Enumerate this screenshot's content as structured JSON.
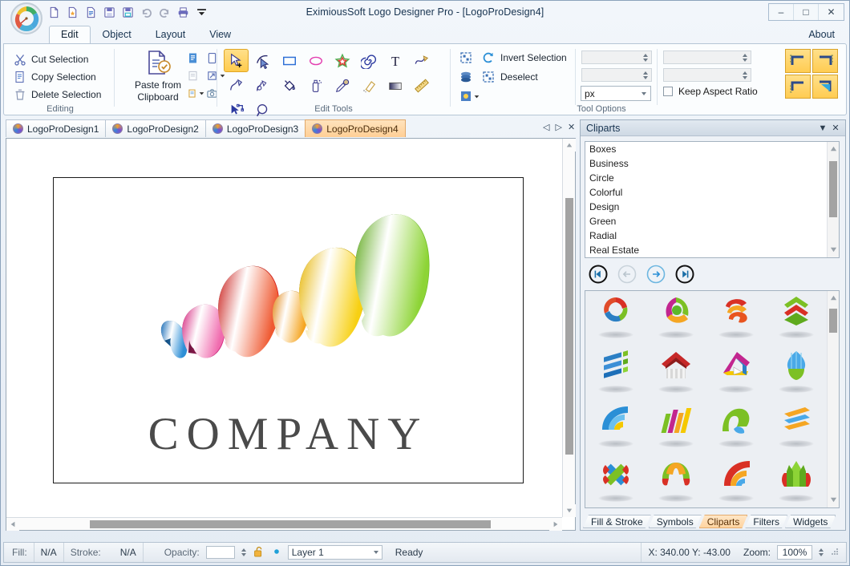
{
  "window": {
    "title": "EximiousSoft Logo Designer Pro - [LogoProDesign4]",
    "minimize": "–",
    "maximize": "□",
    "close": "✕"
  },
  "quick_access": [
    {
      "name": "new-document-icon",
      "tip": "New"
    },
    {
      "name": "new-from-template-icon",
      "tip": "New from template"
    },
    {
      "name": "open-document-icon",
      "tip": "Open"
    },
    {
      "name": "save-icon",
      "tip": "Save"
    },
    {
      "name": "save-as-icon",
      "tip": "Save As"
    },
    {
      "name": "undo-icon",
      "tip": "Undo"
    },
    {
      "name": "redo-icon",
      "tip": "Redo"
    },
    {
      "name": "print-icon",
      "tip": "Print"
    },
    {
      "name": "customize-qat-icon",
      "tip": "Customize"
    }
  ],
  "ribbon": {
    "tabs": [
      "Edit",
      "Object",
      "Layout",
      "View"
    ],
    "active_tab": "Edit",
    "about_label": "About",
    "groups": {
      "editing": {
        "label": "Editing",
        "items": [
          {
            "label": "Cut Selection",
            "icon": "scissors-icon"
          },
          {
            "label": "Copy Selection",
            "icon": "copy-icon"
          },
          {
            "label": "Delete Selection",
            "icon": "trash-icon"
          }
        ],
        "paste_label_line1": "Paste from",
        "paste_label_line2": "Clipboard"
      },
      "edit_tools": {
        "label": "Edit Tools",
        "tools": [
          {
            "name": "select-tool",
            "selected": true
          },
          {
            "name": "node-edit-tool",
            "selected": false
          },
          {
            "name": "rectangle-tool",
            "selected": false
          },
          {
            "name": "ellipse-tool",
            "selected": false
          },
          {
            "name": "star-tool",
            "selected": false
          },
          {
            "name": "spiral-tool",
            "selected": false
          },
          {
            "name": "text-tool",
            "selected": false
          },
          {
            "name": "curve-tool",
            "selected": false
          },
          {
            "name": "pen-tool",
            "selected": false
          },
          {
            "name": "calligraphy-tool",
            "selected": false
          },
          {
            "name": "paint-bucket-tool",
            "selected": false
          },
          {
            "name": "spray-tool",
            "selected": false
          },
          {
            "name": "eyedropper-tool",
            "selected": false
          },
          {
            "name": "eraser-tool",
            "selected": false
          },
          {
            "name": "gradient-tool",
            "selected": false
          },
          {
            "name": "measure-tool",
            "selected": false
          },
          {
            "name": "connector-tool",
            "selected": false
          },
          {
            "name": "zoom-tool",
            "selected": false
          }
        ]
      },
      "tool_options": {
        "label": "Tool Options",
        "select_all_icon": "select-all-icon",
        "stack_icon": "stack-icon",
        "selection_mode_icon": "selection-mode-icon",
        "invert_selection": "Invert Selection",
        "deselect": "Deselect",
        "x_value": "",
        "y_value": "",
        "w_value": "",
        "h_value": "",
        "unit_value": "px",
        "keep_aspect_ratio": "Keep Aspect Ratio",
        "keep_aspect_checked": false,
        "anchor_buttons": [
          "anchor-top-left",
          "anchor-top-right",
          "anchor-bottom-left",
          "anchor-bottom-right"
        ]
      }
    }
  },
  "document_tabs": {
    "tabs": [
      {
        "label": "LogoProDesign1",
        "active": false
      },
      {
        "label": "LogoProDesign2",
        "active": false
      },
      {
        "label": "LogoProDesign3",
        "active": false
      },
      {
        "label": "LogoProDesign4",
        "active": true
      }
    ],
    "nav_prev": "◁",
    "nav_next": "▷",
    "nav_close": "✕"
  },
  "canvas": {
    "company_text": "COMPANY",
    "artwork_name": "colorful-3d-spiral-logo",
    "spiral_colors": [
      "#2e8fd6",
      "#ec4899",
      "#e8342c",
      "#f59a1e",
      "#f5c800",
      "#7ac832"
    ]
  },
  "right_panel": {
    "title": "Cliparts",
    "collapse_icon": "▼",
    "close_icon": "✕",
    "categories": [
      "Boxes",
      "Business",
      "Circle",
      "Colorful",
      "Design",
      "Green",
      "Radial",
      "Real Estate"
    ],
    "nav_buttons": [
      {
        "name": "first-page-button",
        "glyph": "⏮",
        "enabled": true
      },
      {
        "name": "previous-page-button",
        "glyph": "←",
        "enabled": false
      },
      {
        "name": "next-page-button",
        "glyph": "→",
        "enabled": true
      },
      {
        "name": "last-page-button",
        "glyph": "⏭",
        "enabled": true
      }
    ],
    "cliparts": [
      {
        "name": "circular-arrows-clipart",
        "colors": [
          "#e03131",
          "#76bc21",
          "#2f86cf"
        ]
      },
      {
        "name": "triangle-swirl-clipart",
        "colors": [
          "#c2268f",
          "#76bc21",
          "#f5a623"
        ]
      },
      {
        "name": "layered-circle-clipart",
        "colors": [
          "#e03131",
          "#f5a623",
          "#76bc21"
        ]
      },
      {
        "name": "green-chevron-shield-clipart",
        "colors": [
          "#76bc21",
          "#e03131",
          "#2f8f1e"
        ]
      },
      {
        "name": "blue-stripes-clipart",
        "colors": [
          "#2f86cf",
          "#76bc21",
          "#1d5fa8"
        ]
      },
      {
        "name": "red-roof-building-clipart",
        "colors": [
          "#d12b2b",
          "#bdbdbd",
          "#8a1f1f"
        ]
      },
      {
        "name": "triangle-outline-clipart",
        "colors": [
          "#c2268f",
          "#f5c800",
          "#2f86cf"
        ]
      },
      {
        "name": "blue-green-leaf-clipart",
        "colors": [
          "#4aa9e8",
          "#76bc21",
          "#2f86cf"
        ]
      },
      {
        "name": "blue-yellow-arc-clipart",
        "colors": [
          "#2f86cf",
          "#f5c800",
          "#4aa9e8"
        ]
      },
      {
        "name": "colored-bars-clipart",
        "colors": [
          "#76bc21",
          "#c2268f",
          "#f5a623"
        ]
      },
      {
        "name": "green-blue-wave-clipart",
        "colors": [
          "#76bc21",
          "#4aa9e8",
          "#2f8f1e"
        ]
      },
      {
        "name": "orange-ribbon-clipart",
        "colors": [
          "#f5a623",
          "#4aa9e8",
          "#e8721a"
        ]
      },
      {
        "name": "cross-weave-clipart",
        "colors": [
          "#e03131",
          "#76bc21",
          "#2f86cf"
        ]
      },
      {
        "name": "fan-burst-clipart",
        "colors": [
          "#f5a623",
          "#76bc21",
          "#e03131"
        ]
      },
      {
        "name": "red-wifi-arc-clipart",
        "colors": [
          "#e03131",
          "#f5a623",
          "#4aa9e8"
        ]
      },
      {
        "name": "green-towers-clipart",
        "colors": [
          "#76bc21",
          "#e03131",
          "#2f8f1e"
        ]
      }
    ],
    "tabs": [
      {
        "label": "Fill & Stroke",
        "active": false
      },
      {
        "label": "Symbols",
        "active": false
      },
      {
        "label": "Cliparts",
        "active": true
      },
      {
        "label": "Filters",
        "active": false
      },
      {
        "label": "Widgets",
        "active": false
      }
    ]
  },
  "status_bar": {
    "fill_label": "Fill:",
    "fill_value": "N/A",
    "stroke_label": "Stroke:",
    "stroke_value": "N/A",
    "opacity_label": "Opacity:",
    "opacity_value": "",
    "lock_icon": "unlock-icon",
    "visible_icon": "visible-dot-icon",
    "layer_value": "Layer 1",
    "ready_text": "Ready",
    "coords": "X: 340.00 Y:  -43.00",
    "zoom_label": "Zoom:",
    "zoom_value": "100%"
  }
}
